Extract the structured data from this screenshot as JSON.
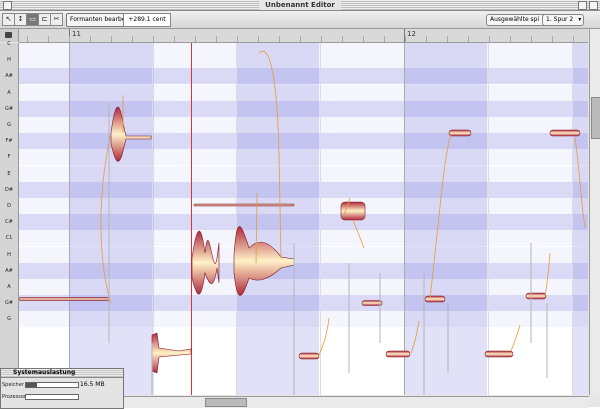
{
  "window": {
    "title": "Unbenannt Editor"
  },
  "toolbar": {
    "tools": [
      "↖",
      "↕",
      "▭",
      "⊏",
      "✂",
      "↔"
    ],
    "formant_button": "Formanten bearbeiten",
    "offset_field": "+289.1 cent",
    "select_left": "Ausgewählte spi",
    "select_right": "1. Spur 2"
  },
  "ruler": {
    "bar_a": "11",
    "bar_b": "12"
  },
  "pitch_labels": [
    "C",
    "H",
    "A#",
    "A",
    "G#",
    "G",
    "F#",
    "F",
    "E",
    "D#",
    "D",
    "C#",
    "C1",
    "H",
    "A#",
    "A",
    "G#",
    "G"
  ],
  "system_monitor": {
    "title": "Systemauslastung",
    "row1_label": "Speicher",
    "row1_value": "16.5 MB",
    "row1_level": 0.22,
    "row2_label": "Prozessor",
    "row2_level": 0.0
  },
  "colors": {
    "blob_dark": "#b0283c",
    "blob_light": "#fff2c8",
    "pitch_line": "#e89a3c",
    "cursor": "#dd3333"
  }
}
